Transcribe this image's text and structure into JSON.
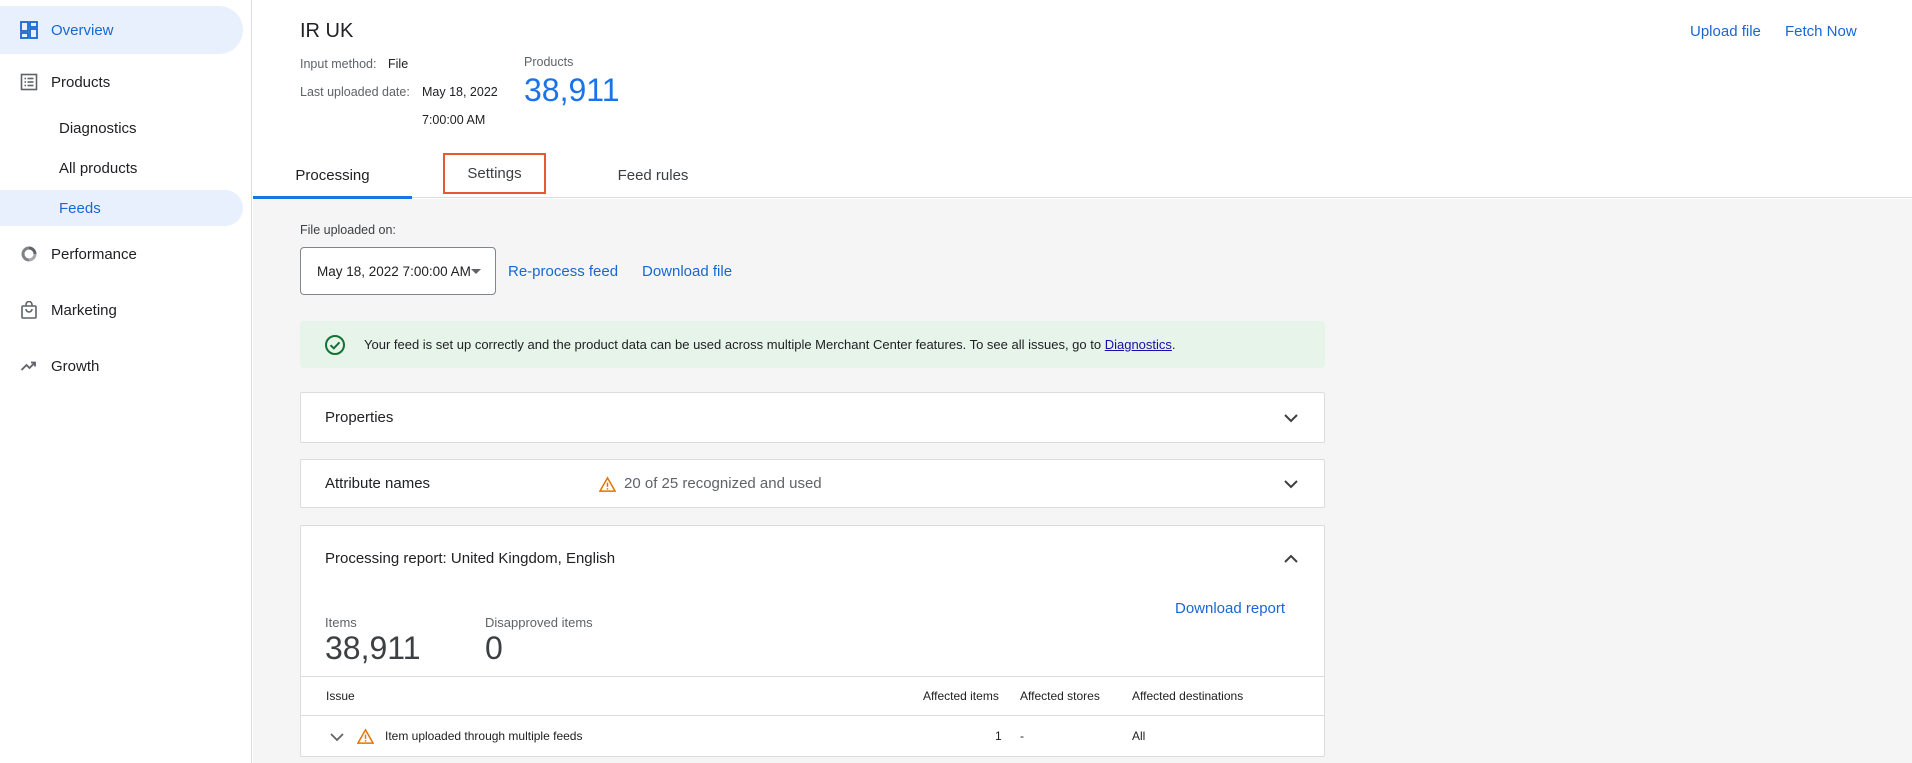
{
  "sidebar": {
    "items": [
      {
        "label": "Overview",
        "icon": "dashboard-icon",
        "active": true
      },
      {
        "label": "Products",
        "icon": "list-icon",
        "active": false
      },
      {
        "label": "Performance",
        "icon": "donut-icon",
        "active": false
      },
      {
        "label": "Marketing",
        "icon": "bag-icon",
        "active": false
      },
      {
        "label": "Growth",
        "icon": "trend-up-icon",
        "active": false
      }
    ],
    "sub_items": [
      {
        "label": "Diagnostics",
        "active": false
      },
      {
        "label": "All products",
        "active": false
      },
      {
        "label": "Feeds",
        "active": true
      }
    ]
  },
  "header": {
    "title": "IR UK",
    "input_method_label": "Input method:",
    "input_method_value": "File",
    "last_uploaded_label": "Last uploaded date:",
    "last_uploaded_date": "May 18, 2022",
    "last_uploaded_time": "7:00:00 AM",
    "products_label": "Products",
    "products_count": "38,911",
    "upload_file": "Upload file",
    "fetch_now": "Fetch Now"
  },
  "tabs": [
    {
      "label": "Processing",
      "active": true
    },
    {
      "label": "Settings",
      "active": false
    },
    {
      "label": "Feed rules",
      "active": false
    }
  ],
  "file": {
    "label": "File uploaded on:",
    "selected": "May 18, 2022 7:00:00 AM",
    "reprocess": "Re-process feed",
    "download": "Download file"
  },
  "banner": {
    "text": "Your feed is set up correctly and the product data can be used across multiple Merchant Center features. To see all issues, go to ",
    "link": "Diagnostics",
    "suffix": "."
  },
  "panels": {
    "properties": "Properties",
    "attribute_names": "Attribute names",
    "attribute_status": "20 of 25 recognized and used",
    "report_title": "Processing report: United Kingdom, English"
  },
  "report": {
    "items_label": "Items",
    "items_value": "38,911",
    "disapproved_label": "Disapproved items",
    "disapproved_value": "0",
    "download_report": "Download report",
    "columns": [
      "Issue",
      "Affected items",
      "Affected stores",
      "Affected destinations"
    ],
    "rows": [
      {
        "issue": "Item uploaded through multiple feeds",
        "affected_items": "1",
        "affected_stores": "-",
        "affected_destinations": "All"
      }
    ]
  },
  "colors": {
    "accent": "#1a73e8",
    "active_bg": "#e8f0fe",
    "success_bg": "#e6f4ea",
    "warning": "#e37400",
    "highlight_border": "#e55a33"
  }
}
